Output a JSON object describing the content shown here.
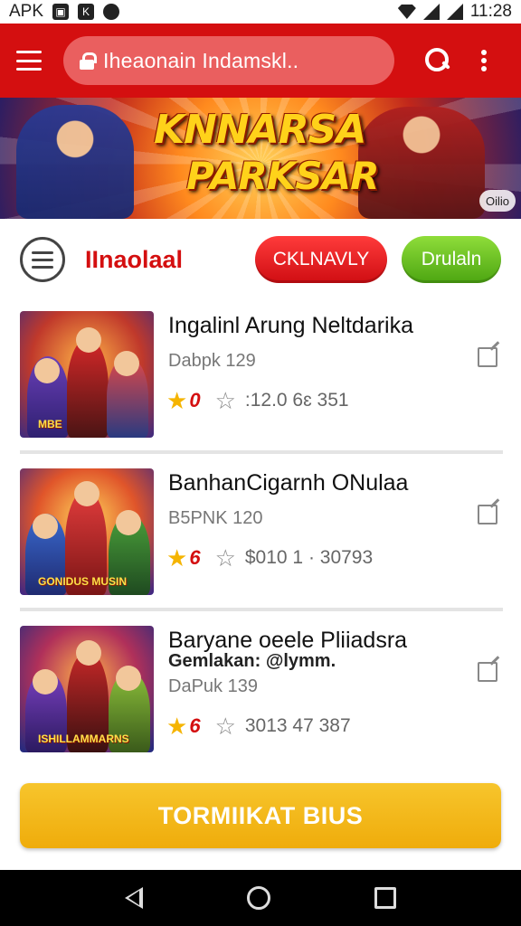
{
  "status_bar": {
    "left_label": "APK",
    "left_icons": [
      "image-icon",
      "k-icon",
      "circle-icon"
    ],
    "time": "11:28",
    "right_icons": [
      "wifi-icon",
      "signal-icon",
      "signal-icon",
      "battery-icon"
    ]
  },
  "app_bar": {
    "search_text": "Iheaonain Indamskl..",
    "icons": [
      "menu-icon",
      "lock-icon",
      "search-icon",
      "more-vert-icon"
    ],
    "color": "#d40f10"
  },
  "banner": {
    "title": "KNNARSA",
    "subtitle": "PARKSAR",
    "badge": "Oilio"
  },
  "tabs": {
    "label": "IInaolaal",
    "red_button": "CKLNAVLY",
    "green_button": "Drulaln"
  },
  "items": [
    {
      "title": "Ingalinl Arung Neltdarika",
      "subtitle": "",
      "meta": "Dabpk  129",
      "rating": "0",
      "stats": ":12.0 6ɛ  351",
      "thumb_caption": "MBE"
    },
    {
      "title": "BanhanCigarnh ONulaa",
      "subtitle": "",
      "meta": "B5PNK 120",
      "rating": "6",
      "stats": "$010 1 · 30793",
      "thumb_caption": "GONIDUS MUSIN"
    },
    {
      "title": "Baryane oeele Pliiadsra",
      "subtitle": "Gemlakan: @lymm.",
      "meta": "DaPuk 139",
      "rating": "6",
      "stats": "3013 47 387",
      "thumb_caption": "ISHILLAMMARNS"
    }
  ],
  "cta": {
    "label": "TORMIIKAT BIUS",
    "color": "#f2b81a"
  },
  "nav_bar": {
    "icons": [
      "back-icon",
      "home-icon",
      "recents-icon"
    ]
  }
}
